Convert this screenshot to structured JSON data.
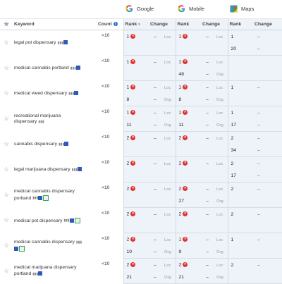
{
  "engines": [
    {
      "name": "Google",
      "icon": "google-icon"
    },
    {
      "name": "Mobile",
      "icon": "google-mobile-icon"
    },
    {
      "name": "Maps",
      "icon": "maps-icon"
    }
  ],
  "headers": {
    "keyword": "Keyword",
    "count": "Count",
    "rank": "Rank",
    "change": "Change"
  },
  "rows": [
    {
      "keyword": "legal pot dispensary",
      "count": "<10",
      "badges": "one",
      "a": {
        "g_rank": "1",
        "g_bad": true,
        "g_change": "–",
        "g_type": "Loc",
        "m_rank": "1",
        "m_bad": true,
        "m_change": "–",
        "m_type": "Loc",
        "maps_rank": "1",
        "maps_change": "–"
      },
      "b": {
        "g_rank": "",
        "g_change": "",
        "g_type": "",
        "m_rank": "",
        "m_change": "",
        "m_type": "",
        "maps_rank": "20",
        "maps_change": "–"
      }
    },
    {
      "keyword": "medical cannabis portland",
      "count": "<10",
      "badges": "one",
      "a": {
        "g_rank": "1",
        "g_bad": true,
        "g_change": "–",
        "g_type": "Loc",
        "m_rank": "1",
        "m_bad": true,
        "m_change": "–",
        "m_type": "Loc",
        "maps_rank": "",
        "maps_change": ""
      },
      "b": {
        "g_rank": "",
        "g_change": "",
        "g_type": "",
        "m_rank": "48",
        "m_change": "–",
        "m_type": "Org",
        "maps_rank": "",
        "maps_change": ""
      }
    },
    {
      "keyword": "medical weed dispensary",
      "count": "<10",
      "badges": "one",
      "a": {
        "g_rank": "1",
        "g_bad": true,
        "g_change": "–",
        "g_type": "Loc",
        "m_rank": "1",
        "m_bad": true,
        "m_change": "–",
        "m_type": "Loc",
        "maps_rank": "1",
        "maps_change": "–"
      },
      "b": {
        "g_rank": "8",
        "g_change": "–",
        "g_type": "Org",
        "m_rank": "8",
        "m_change": "–",
        "m_type": "Org",
        "maps_rank": "",
        "maps_change": ""
      }
    },
    {
      "keyword": "recreational marijuana dispensary",
      "count": "<10",
      "badges": "none",
      "a": {
        "g_rank": "1",
        "g_bad": true,
        "g_change": "–",
        "g_type": "Loc",
        "m_rank": "1",
        "m_bad": true,
        "m_change": "–",
        "m_type": "Loc",
        "maps_rank": "1",
        "maps_change": "–"
      },
      "b": {
        "g_rank": "11",
        "g_change": "–",
        "g_type": "Org",
        "m_rank": "11",
        "m_change": "–",
        "m_type": "Org",
        "maps_rank": "17",
        "maps_change": "–"
      }
    },
    {
      "keyword": "cannabis dispensary",
      "count": "<10",
      "badges": "one",
      "a": {
        "g_rank": "2",
        "g_bad": true,
        "g_change": "–",
        "g_type": "Loc",
        "m_rank": "2",
        "m_bad": true,
        "m_change": "–",
        "m_type": "Loc",
        "maps_rank": "2",
        "maps_change": "–"
      },
      "b": {
        "g_rank": "",
        "g_change": "",
        "g_type": "",
        "m_rank": "",
        "m_change": "",
        "m_type": "",
        "maps_rank": "34",
        "maps_change": "–"
      }
    },
    {
      "keyword": "legal marijuana dispensary",
      "count": "<10",
      "badges": "one",
      "a": {
        "g_rank": "2",
        "g_bad": true,
        "g_change": "–",
        "g_type": "Loc",
        "m_rank": "2",
        "m_bad": true,
        "m_change": "–",
        "m_type": "Loc",
        "maps_rank": "2",
        "maps_change": "–"
      },
      "b": {
        "g_rank": "",
        "g_change": "",
        "g_type": "",
        "m_rank": "",
        "m_change": "",
        "m_type": "",
        "maps_rank": "17",
        "maps_change": "–"
      }
    },
    {
      "keyword": "medical cannabis dispensary portland",
      "count": "<10",
      "badges": "two",
      "a": {
        "g_rank": "2",
        "g_bad": true,
        "g_change": "–",
        "g_type": "Loc",
        "m_rank": "2",
        "m_bad": true,
        "m_change": "–",
        "m_type": "Loc",
        "maps_rank": "2",
        "maps_change": "–"
      },
      "b": {
        "g_rank": "",
        "g_change": "",
        "g_type": "",
        "m_rank": "27",
        "m_change": "–",
        "m_type": "Org",
        "maps_rank": "",
        "maps_change": ""
      }
    },
    {
      "keyword": "medical pot dispensary",
      "count": "<10",
      "badges": "two",
      "a": {
        "g_rank": "2",
        "g_bad": true,
        "g_change": "–",
        "g_type": "Loc",
        "m_rank": "2",
        "m_bad": true,
        "m_change": "–",
        "m_type": "Loc",
        "maps_rank": "2",
        "maps_change": "–"
      },
      "b": {
        "g_rank": "",
        "g_change": "",
        "g_type": "",
        "m_rank": "",
        "m_change": "",
        "m_type": "",
        "maps_rank": "",
        "maps_change": ""
      }
    },
    {
      "keyword": "medical cannabis dispensary",
      "count": "<10",
      "badges": "two",
      "a": {
        "g_rank": "2",
        "g_bad": true,
        "g_change": "–",
        "g_type": "Loc",
        "m_rank": "1",
        "m_bad": true,
        "m_change": "–",
        "m_type": "Loc",
        "maps_rank": "1",
        "maps_change": "–"
      },
      "b": {
        "g_rank": "10",
        "g_change": "–",
        "g_type": "Org",
        "m_rank": "9",
        "m_change": "–",
        "m_type": "Org",
        "maps_rank": "",
        "maps_change": ""
      }
    },
    {
      "keyword": "medical marijuana dispensary portland",
      "count": "<10",
      "badges": "one",
      "a": {
        "g_rank": "2",
        "g_bad": true,
        "g_change": "–",
        "g_type": "Loc",
        "m_rank": "2",
        "m_bad": true,
        "m_change": "–",
        "m_type": "Loc",
        "maps_rank": "2",
        "maps_change": "–"
      },
      "b": {
        "g_rank": "21",
        "g_change": "–",
        "g_type": "Org",
        "m_rank": "21",
        "m_change": "–",
        "m_type": "Org",
        "maps_rank": "",
        "maps_change": ""
      }
    }
  ]
}
